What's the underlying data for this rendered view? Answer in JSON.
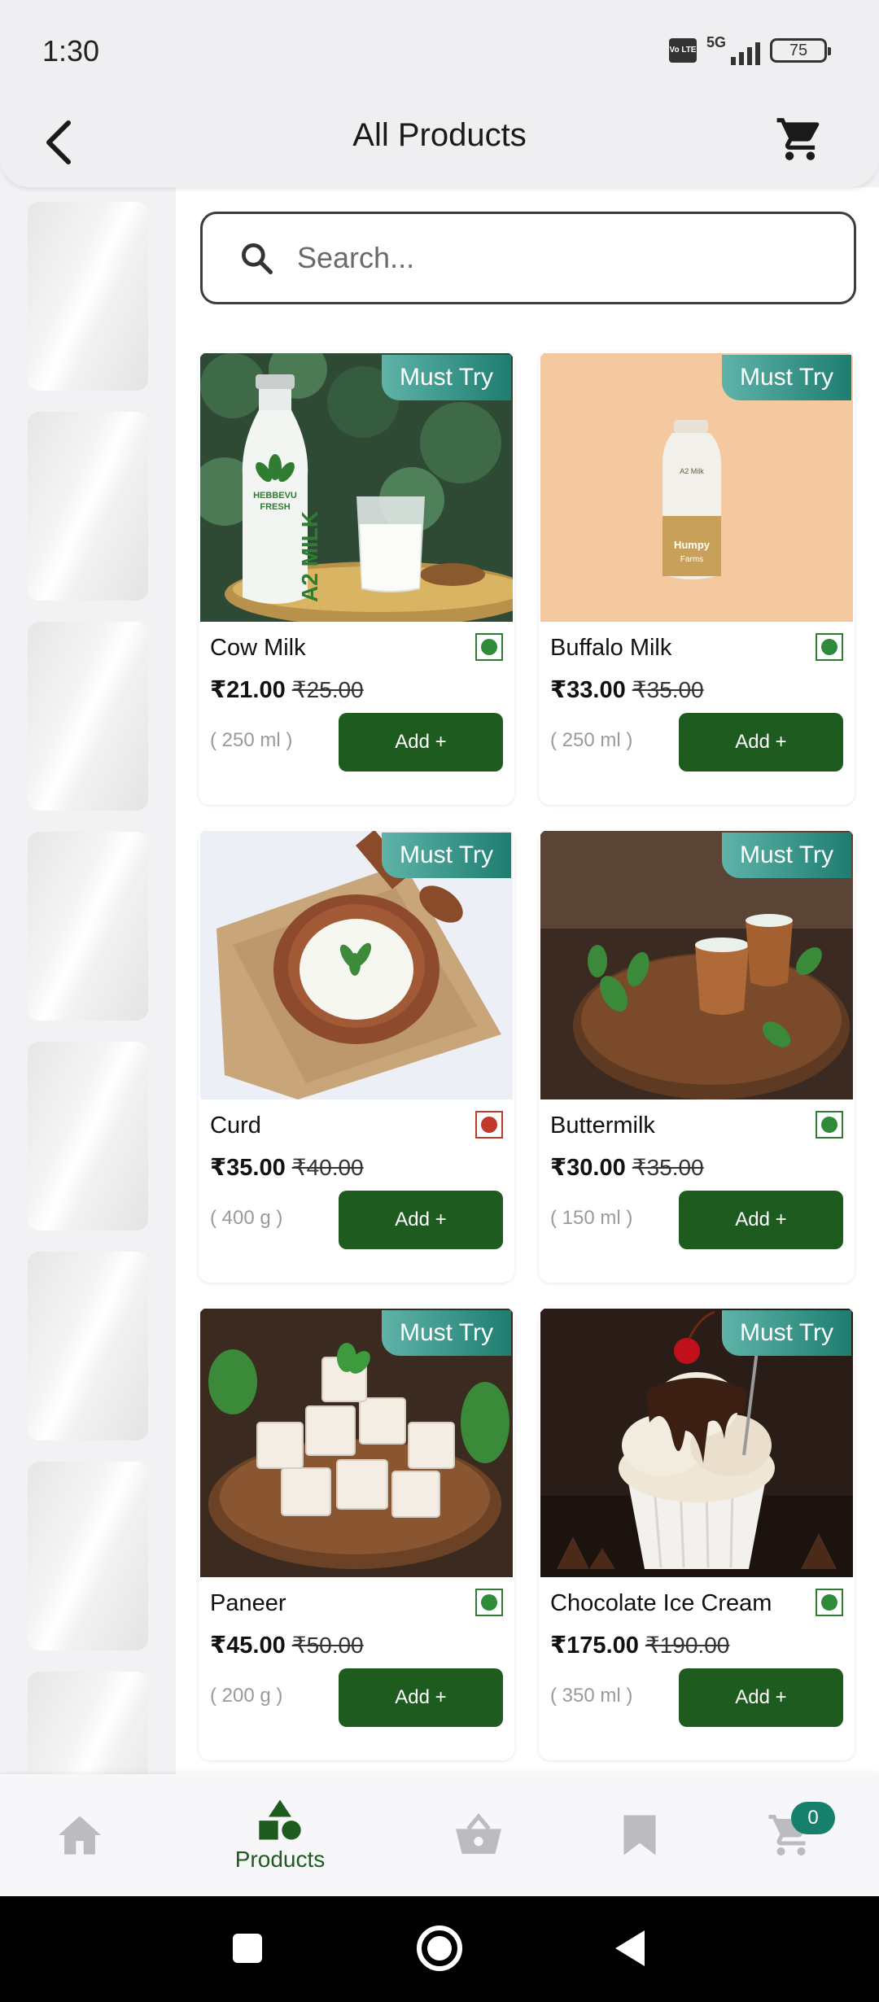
{
  "status_bar": {
    "time": "1:30",
    "volte": "Vo LTE",
    "network": "5G",
    "battery": "75"
  },
  "header": {
    "title": "All Products"
  },
  "search": {
    "placeholder": "Search..."
  },
  "products": [
    {
      "name": "Cow Milk",
      "price": "₹21.00",
      "mrp": "₹25.00",
      "quantity": "( 250 ml )",
      "badge": "Must Try",
      "add_label": "Add +",
      "diet_mark": "green"
    },
    {
      "name": "Buffalo Milk",
      "price": "₹33.00",
      "mrp": "₹35.00",
      "quantity": "( 250 ml )",
      "badge": "Must Try",
      "add_label": "Add +",
      "diet_mark": "green"
    },
    {
      "name": "Curd",
      "price": "₹35.00",
      "mrp": "₹40.00",
      "quantity": "( 400 g )",
      "badge": "Must Try",
      "add_label": "Add +",
      "diet_mark": "red"
    },
    {
      "name": "Buttermilk",
      "price": "₹30.00",
      "mrp": "₹35.00",
      "quantity": "( 150 ml )",
      "badge": "Must Try",
      "add_label": "Add +",
      "diet_mark": "green"
    },
    {
      "name": "Paneer",
      "price": "₹45.00",
      "mrp": "₹50.00",
      "quantity": "( 200 g )",
      "badge": "Must Try",
      "add_label": "Add +",
      "diet_mark": "green"
    },
    {
      "name": "Chocolate Ice Cream",
      "price": "₹175.00",
      "mrp": "₹190.00",
      "quantity": "( 350 ml )",
      "badge": "Must Try",
      "add_label": "Add +",
      "diet_mark": "green"
    }
  ],
  "image_text": {
    "bottle_brand": "HEBBEVU FRESH",
    "bottle_label": "A2 MILK",
    "bottle2_label": "A2 Milk",
    "bottle2_brand": "Humpy Farms"
  },
  "bottom_nav": {
    "items": [
      {
        "icon": "home-icon",
        "label": ""
      },
      {
        "icon": "products-icon",
        "label": "Products",
        "active": true
      },
      {
        "icon": "basket-icon",
        "label": ""
      },
      {
        "icon": "bookmark-icon",
        "label": ""
      },
      {
        "icon": "cart-icon",
        "label": ""
      }
    ],
    "cart_count": "0"
  },
  "colors": {
    "primary_green": "#1e5b1f",
    "badge_teal": "#1e7d70",
    "cart_badge": "#17806c",
    "veg_green": "#2e8b3a",
    "nonveg_red": "#c0392b"
  }
}
